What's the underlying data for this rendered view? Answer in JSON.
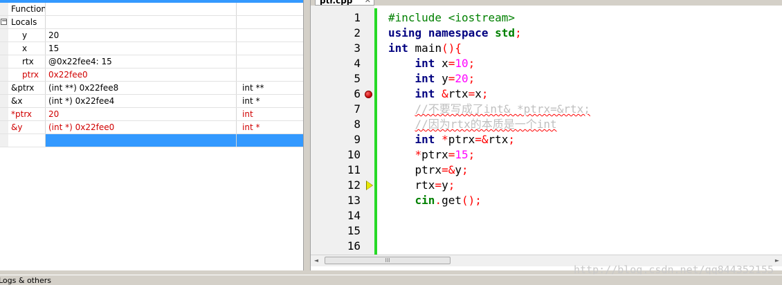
{
  "watch": {
    "rows": [
      {
        "name": "Function",
        "value": "",
        "type": ""
      },
      {
        "name": "Locals",
        "value": "",
        "type": "",
        "expander": "−"
      },
      {
        "name": "y",
        "value": "20",
        "type": ""
      },
      {
        "name": "x",
        "value": "15",
        "type": ""
      },
      {
        "name": "rtx",
        "value": "@0x22fee4: 15",
        "type": ""
      },
      {
        "name": "ptrx",
        "value": "0x22fee0",
        "type": ""
      },
      {
        "name": "&ptrx",
        "value": "(int **) 0x22fee8",
        "type": "int **"
      },
      {
        "name": "&x",
        "value": "(int *) 0x22fee4",
        "type": "int *"
      },
      {
        "name": "*ptrx",
        "value": "20",
        "type": "int"
      },
      {
        "name": "&y",
        "value": "(int *) 0x22fee0",
        "type": "int *"
      }
    ],
    "ellipsis_label": "..."
  },
  "editor": {
    "tab_label": "ptr.cpp",
    "tab_close": "✕",
    "line_numbers": [
      "1",
      "2",
      "3",
      "4",
      "5",
      "6",
      "7",
      "8",
      "9",
      "10",
      "11",
      "12",
      "13",
      "14",
      "15",
      "16"
    ],
    "code": {
      "l1": {
        "pp": "#include <iostream>"
      },
      "l2": {
        "kw1": "using",
        "kw2": "namespace",
        "lib": "std",
        "semi": ";"
      },
      "l3": {
        "kw": "int",
        "id": "main",
        "paren": "(){"
      },
      "l4": {
        "kw": "int",
        "id": "x",
        "op": "=",
        "num": "10",
        "semi": ";"
      },
      "l5": {
        "kw": "int",
        "id": "y",
        "op": "=",
        "num": "20",
        "semi": ";"
      },
      "l6": {
        "kw": "int",
        "amp": "&",
        "id1": "rtx",
        "op": "=",
        "id2": "x",
        "semi": ";"
      },
      "l7": {
        "cmt": "//不要写成了int& *ptrx=&rtx;"
      },
      "l8": {
        "cmt": "//因为rtx的本质是一个int"
      },
      "l9": {
        "kw": "int",
        "star": "*",
        "id1": "ptrx",
        "op": "=&",
        "id2": "rtx",
        "semi": ";"
      },
      "l10": {
        "star": "*",
        "id": "ptrx",
        "op": "=",
        "num": "15",
        "semi": ";"
      },
      "l11": {
        "id1": "ptrx",
        "op": "=&",
        "id2": "y",
        "semi": ";"
      },
      "l12": {
        "id1": "rtx",
        "op": "=",
        "id2": "y",
        "semi": ";"
      },
      "l13": {
        "lib": "cin",
        "dot": ".",
        "id": "get",
        "paren": "();"
      }
    },
    "breakpoint_line": 6,
    "current_line": 12,
    "scroll_thumb_grip": "III",
    "scroll_left": "◄",
    "scroll_right": "►"
  },
  "watermark": "http://blog.csdn.net/qq844352155",
  "bottom_tab": "Logs & others",
  "colors": {
    "selection": "#3399ff",
    "change_bar": "#26d926",
    "keyword": "#000080",
    "number": "#ff00ff",
    "operator": "#ff0000",
    "comment": "#c0c0c0",
    "preprocessor": "#008000",
    "red_watch_text": "#d00000"
  }
}
